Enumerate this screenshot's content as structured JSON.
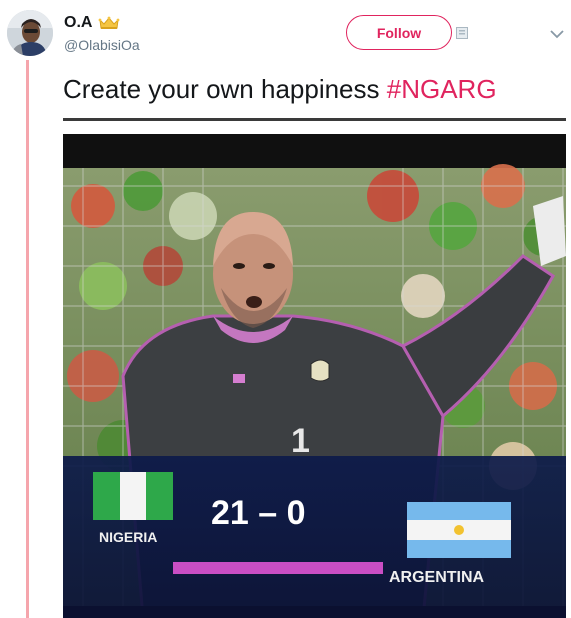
{
  "user": {
    "display_name": "O.A",
    "handle": "@OlabisiOa",
    "badge_icon": "crown-emoji-icon"
  },
  "actions": {
    "follow_label": "Follow"
  },
  "tweet": {
    "text": "Create your own happiness ",
    "hashtag": "#NGARG"
  },
  "media": {
    "description_icons": [
      "goalkeeper-image"
    ],
    "score": "21 – 0",
    "team_left": "NIGERIA",
    "team_right": "ARGENTINA",
    "jersey_number": "1"
  },
  "colors": {
    "accent": "#e0245e",
    "thread_line": "#f5a5ac",
    "handle_gray": "#657786"
  }
}
